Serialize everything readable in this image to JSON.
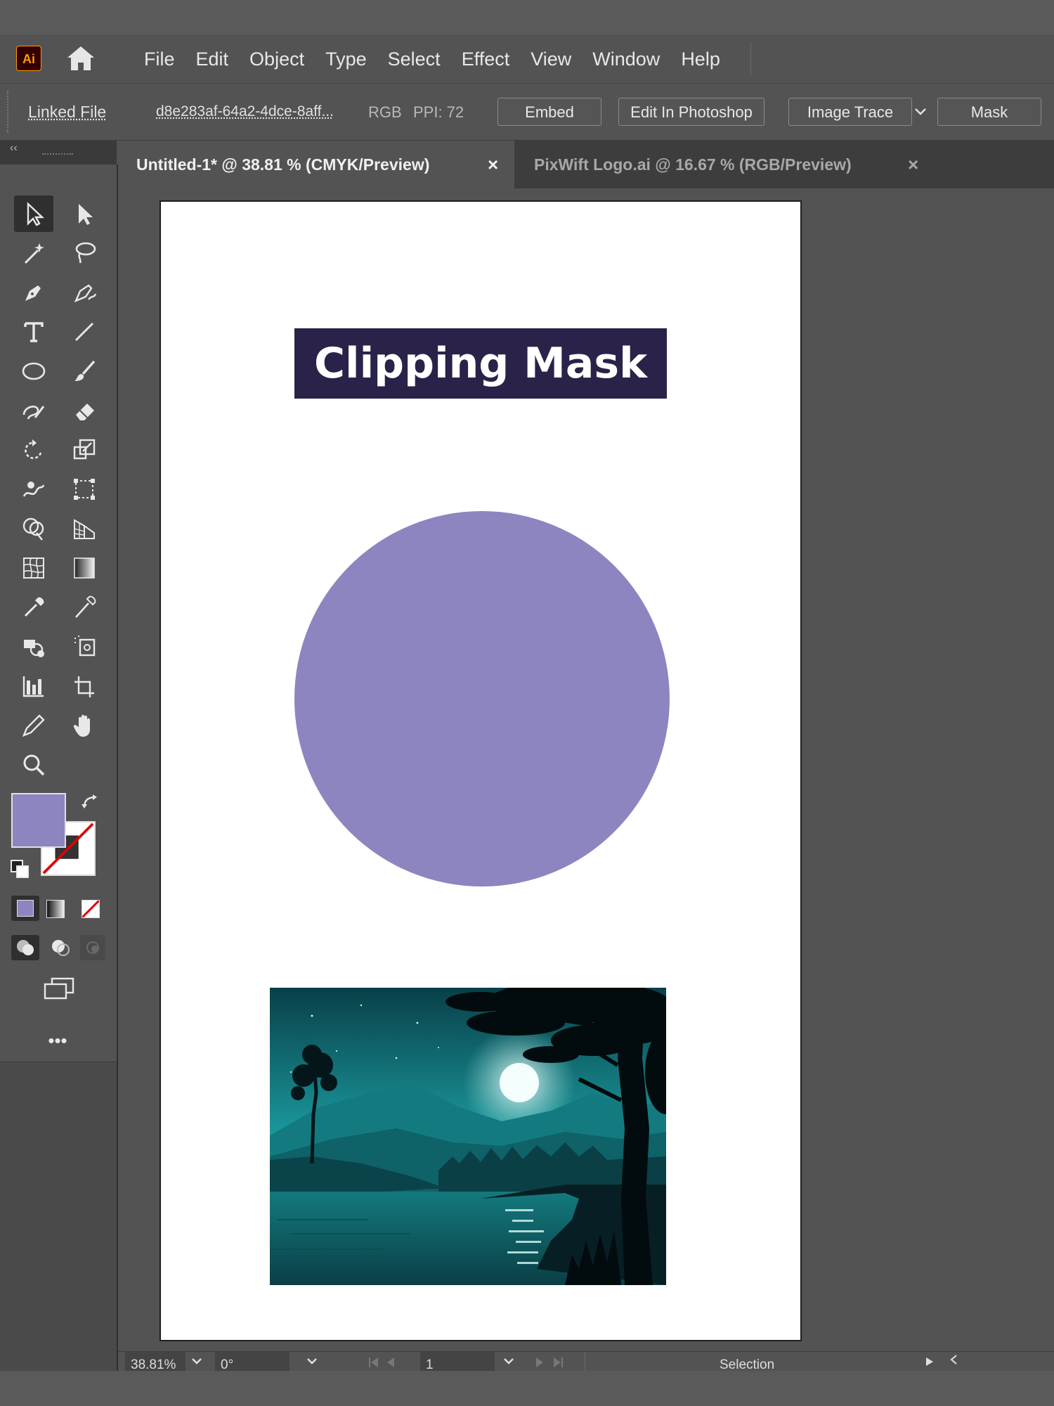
{
  "app": {
    "logo": "Ai",
    "brand_color": "#ff9a00"
  },
  "menu": [
    "File",
    "Edit",
    "Object",
    "Type",
    "Select",
    "Effect",
    "View",
    "Window",
    "Help"
  ],
  "control_bar": {
    "linked_file_label": "Linked File",
    "file_name": "d8e283af-64a2-4dce-8aff...",
    "color_mode": "RGB",
    "ppi": "PPI: 72",
    "embed_label": "Embed",
    "edit_in_photoshop_label": "Edit In Photoshop",
    "image_trace_label": "Image Trace",
    "mask_label": "Mask"
  },
  "panel_collapse": "‹‹",
  "tabs": [
    {
      "label": "Untitled-1* @ 38.81 % (CMYK/Preview)",
      "close": "×"
    },
    {
      "label": "PixWift Logo.ai @ 16.67 % (RGB/Preview)",
      "close": "×"
    }
  ],
  "tools": [
    "selection-tool",
    "direct-selection-tool",
    "magic-wand-tool",
    "lasso-tool",
    "pen-tool",
    "curvature-tool",
    "type-tool",
    "line-segment-tool",
    "ellipse-tool",
    "paintbrush-tool",
    "shaper-tool",
    "eraser-tool",
    "rotate-tool",
    "scale-tool",
    "warp-tool",
    "free-transform-tool",
    "shape-builder-tool",
    "perspective-grid-tool",
    "mesh-tool",
    "gradient-tool",
    "eyedropper-tool",
    "eyedropper-alt-tool",
    "symbol-sprayer-tool",
    "artboard-tool",
    "column-graph-tool",
    "slice-tool",
    "pencil-tool",
    "hand-tool",
    "zoom-tool"
  ],
  "colors": {
    "fill": "#8d85c0",
    "stroke": "none",
    "title_bg": "#2a2248",
    "circle": "#8d85c0"
  },
  "more_tools": "•••",
  "artboard": {
    "title": "Clipping Mask"
  },
  "status_bar": {
    "zoom": "38.81%",
    "rotation": "0°",
    "artboard_number": "1",
    "tool_name": "Selection"
  }
}
